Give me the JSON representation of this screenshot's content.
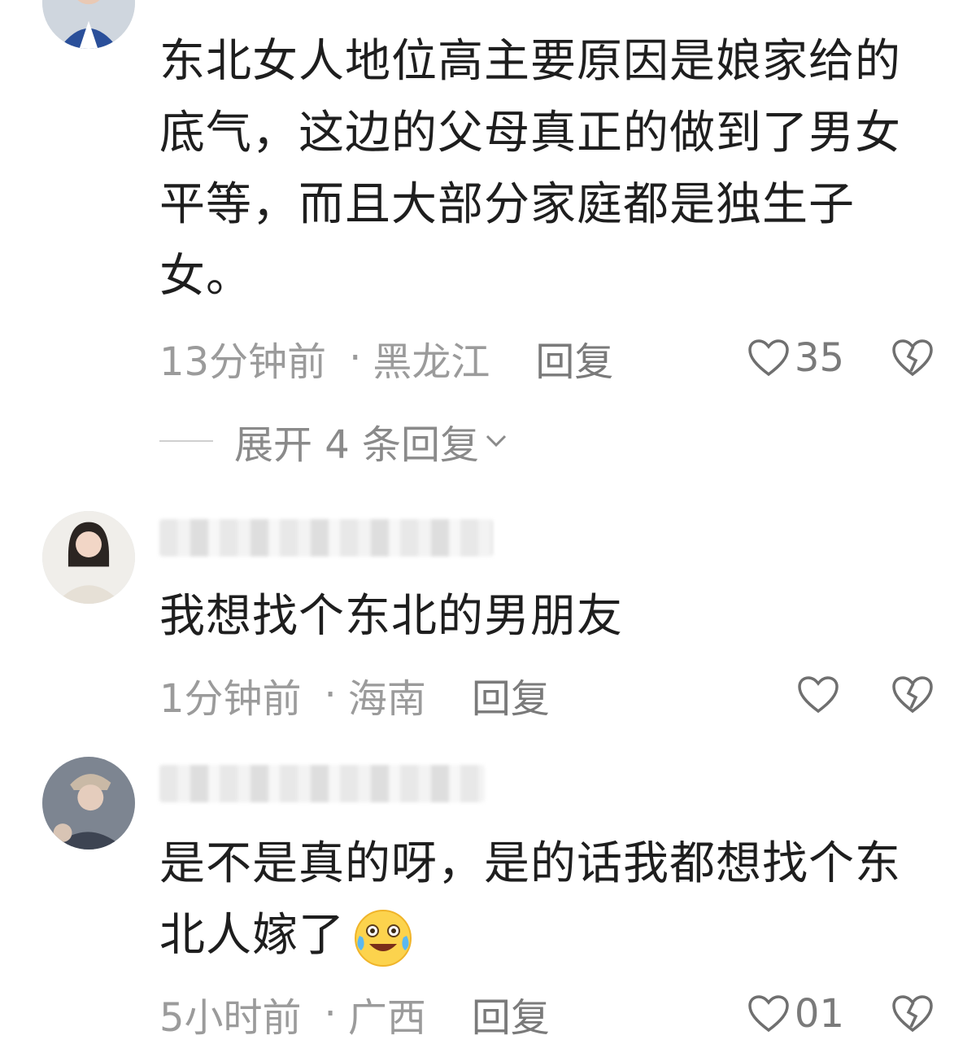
{
  "comments": [
    {
      "body": "东北女人地位高主要原因是娘家给的底气，这边的父母真正的做到了男女平等，而且大部分家庭都是独生子女。",
      "time": "13分钟前",
      "location": "黑龙江",
      "reply_label": "回复",
      "likes": "35",
      "expand_label": "展开 4 条回复"
    },
    {
      "body": "我想找个东北的男朋友",
      "time": "1分钟前",
      "location": "海南",
      "reply_label": "回复",
      "likes": ""
    },
    {
      "body": "是不是真的呀，是的话我都想找个东北人嫁了",
      "time": "5小时前",
      "location": "广西",
      "reply_label": "回复",
      "likes": "01"
    }
  ],
  "separator": "·",
  "icons": {
    "like": "heart-outline-icon",
    "dislike": "broken-heart-icon",
    "expand": "chevron-down-icon",
    "emoji": "crying-laughing-emoji-icon"
  },
  "colors": {
    "text": "#1e1e1e",
    "meta": "#9b9b9b",
    "icon": "#6f6f6f"
  }
}
